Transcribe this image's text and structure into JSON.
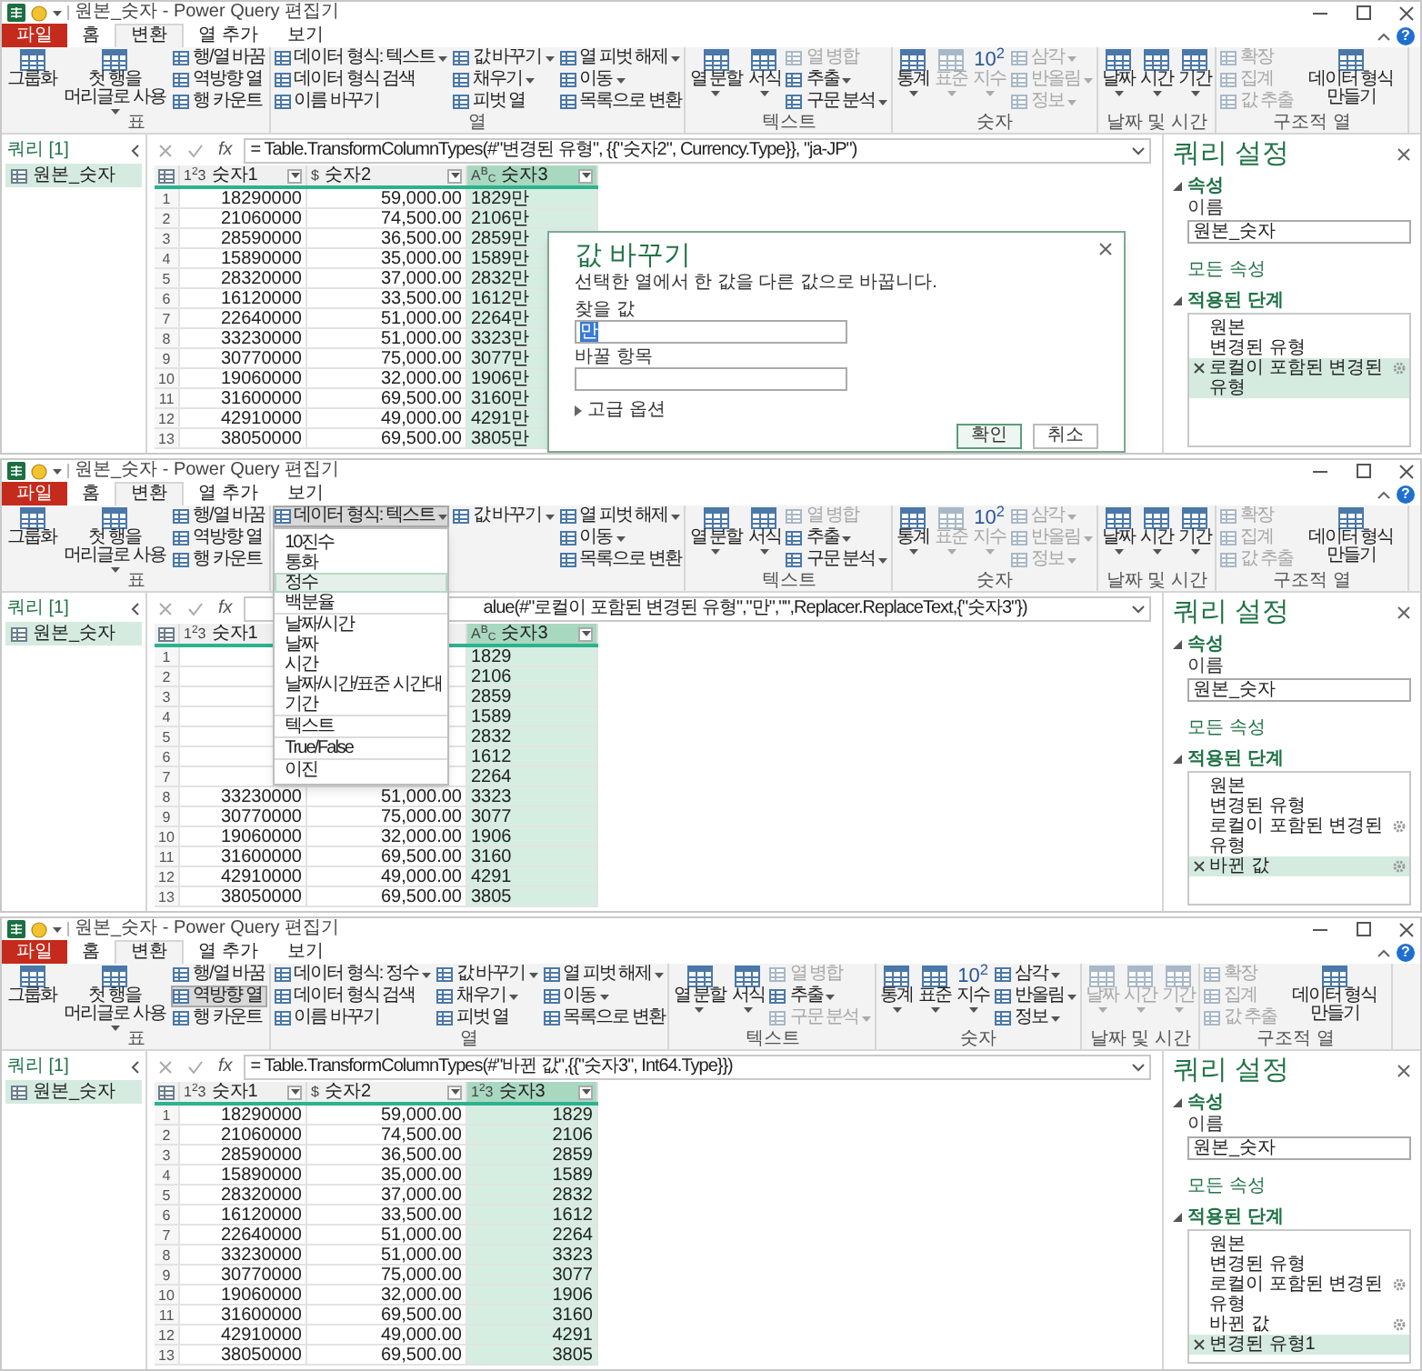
{
  "windows": [
    {
      "title": "원본_숫자 - Power Query 편집기",
      "tabs": [
        {
          "label": "파일",
          "kind": "file",
          "selected": false
        },
        {
          "label": "홈",
          "kind": "tab",
          "selected": false
        },
        {
          "label": "변환",
          "kind": "tab",
          "selected": true
        },
        {
          "label": "열 추가",
          "kind": "tab",
          "selected": false
        },
        {
          "label": "보기",
          "kind": "tab",
          "selected": false
        }
      ],
      "help": "?",
      "ribbon": [
        {
          "label": "표",
          "stacks": [
            [
              {
                "label": "그룹화",
                "kind": "large",
                "menu": false,
                "disabled": false,
                "pressed": false
              }
            ],
            [
              {
                "label": "첫 행을 머리글로 사용",
                "kind": "large",
                "menu": true,
                "disabled": false,
                "pressed": false
              }
            ],
            [
              {
                "label": "행/열 바꿈",
                "kind": "small",
                "menu": false,
                "disabled": false,
                "pressed": false
              },
              {
                "label": "역방향 열",
                "kind": "small",
                "menu": false,
                "disabled": false,
                "pressed": false
              },
              {
                "label": "행 카운트",
                "kind": "small",
                "menu": false,
                "disabled": false,
                "pressed": false
              }
            ]
          ]
        },
        {
          "label": "열",
          "stacks": [
            [
              {
                "label": "데이터 형식: 텍스트",
                "kind": "small",
                "menu": true,
                "disabled": false,
                "pressed": false
              },
              {
                "label": "데이터 형식 검색",
                "kind": "small",
                "menu": false,
                "disabled": false,
                "pressed": false
              },
              {
                "label": "이름 바꾸기",
                "kind": "small",
                "menu": false,
                "disabled": false,
                "pressed": false
              }
            ],
            [
              {
                "label": "값 바꾸기",
                "kind": "small",
                "menu": true,
                "disabled": false,
                "pressed": false
              },
              {
                "label": "채우기",
                "kind": "small",
                "menu": true,
                "disabled": false,
                "pressed": false
              },
              {
                "label": "피벗 열",
                "kind": "small",
                "menu": false,
                "disabled": false,
                "pressed": false
              }
            ],
            [
              {
                "label": "열 피벗 해제",
                "kind": "small",
                "menu": true,
                "disabled": false,
                "pressed": false
              },
              {
                "label": "이동",
                "kind": "small",
                "menu": true,
                "disabled": false,
                "pressed": false
              },
              {
                "label": "목록으로 변환",
                "kind": "small",
                "menu": false,
                "disabled": false,
                "pressed": false
              }
            ]
          ]
        },
        {
          "label": "텍스트",
          "stacks": [
            [
              {
                "label": "열 분할",
                "kind": "large",
                "menu": true,
                "disabled": false,
                "pressed": false
              }
            ],
            [
              {
                "label": "서식",
                "kind": "large",
                "menu": true,
                "disabled": false,
                "pressed": false
              }
            ],
            [
              {
                "label": "열 병합",
                "kind": "small",
                "menu": false,
                "disabled": true,
                "pressed": false
              },
              {
                "label": "추출",
                "kind": "small",
                "menu": true,
                "disabled": false,
                "pressed": false
              },
              {
                "label": "구문 분석",
                "kind": "small",
                "menu": true,
                "disabled": false,
                "pressed": false
              }
            ]
          ]
        },
        {
          "label": "숫자",
          "stacks": [
            [
              {
                "label": "통계",
                "kind": "large",
                "menu": true,
                "disabled": false,
                "pressed": false
              }
            ],
            [
              {
                "label": "표준",
                "kind": "large",
                "menu": true,
                "disabled": true,
                "pressed": false
              }
            ],
            [
              {
                "label": "지수",
                "glyph": "10$^{2}$",
                "kind": "large",
                "menu": true,
                "disabled": true,
                "pressed": false
              }
            ],
            [
              {
                "label": "삼각",
                "kind": "small",
                "menu": true,
                "disabled": true,
                "pressed": false
              },
              {
                "label": "반올림",
                "kind": "small",
                "menu": true,
                "disabled": true,
                "pressed": false
              },
              {
                "label": "정보",
                "kind": "small",
                "menu": true,
                "disabled": true,
                "pressed": false
              }
            ]
          ]
        },
        {
          "label": "날짜 및 시간",
          "stacks": [
            [
              {
                "label": "날짜",
                "kind": "large",
                "menu": true,
                "disabled": false,
                "pressed": false
              }
            ],
            [
              {
                "label": "시간",
                "kind": "large",
                "menu": true,
                "disabled": false,
                "pressed": false
              }
            ],
            [
              {
                "label": "기간",
                "kind": "large",
                "menu": true,
                "disabled": false,
                "pressed": false
              }
            ]
          ]
        },
        {
          "label": "구조적 열",
          "stacks": [
            [
              {
                "label": "확장",
                "kind": "small",
                "menu": false,
                "disabled": true,
                "pressed": false
              },
              {
                "label": "집계",
                "kind": "small",
                "menu": false,
                "disabled": true,
                "pressed": false
              },
              {
                "label": "값 추출",
                "kind": "small",
                "menu": false,
                "disabled": true,
                "pressed": false
              }
            ],
            [
              {
                "label": "데이터 형식 만들기",
                "kind": "large",
                "menu": false,
                "disabled": false,
                "pressed": false
              }
            ]
          ]
        }
      ],
      "queries": {
        "title": "쿼리 [1]",
        "items": [
          {
            "label": "원본_숫자",
            "selected": true
          }
        ]
      },
      "formula": {
        "fx": "fx",
        "text": "= Table.TransformColumnTypes(#\"변경된 유형\", {{\"숫자2\", Currency.Type}}, \"ja-JP\")"
      },
      "table": {
        "columns": [
          {
            "type_mark": "1$^{2}$3",
            "name": "숫자1",
            "kind": "integer",
            "filter": true,
            "selected": false
          },
          {
            "type_mark": "$",
            "name": "숫자2",
            "kind": "currency",
            "filter": true,
            "selected": false
          },
          {
            "type_mark": "A$^{B}$$_{C}$",
            "name": "숫자3",
            "kind": "text",
            "filter": true,
            "selected": true
          }
        ],
        "rows": [
          {
            "number": "1",
            "cells": [
              "18290000",
              "59,000.00",
              "1829만"
            ]
          },
          {
            "number": "2",
            "cells": [
              "21060000",
              "74,500.00",
              "2106만"
            ]
          },
          {
            "number": "3",
            "cells": [
              "28590000",
              "36,500.00",
              "2859만"
            ]
          },
          {
            "number": "4",
            "cells": [
              "15890000",
              "35,000.00",
              "1589만"
            ]
          },
          {
            "number": "5",
            "cells": [
              "28320000",
              "37,000.00",
              "2832만"
            ]
          },
          {
            "number": "6",
            "cells": [
              "16120000",
              "33,500.00",
              "1612만"
            ]
          },
          {
            "number": "7",
            "cells": [
              "22640000",
              "51,000.00",
              "2264만"
            ]
          },
          {
            "number": "8",
            "cells": [
              "33230000",
              "51,000.00",
              "3323만"
            ]
          },
          {
            "number": "9",
            "cells": [
              "30770000",
              "75,000.00",
              "3077만"
            ]
          },
          {
            "number": "10",
            "cells": [
              "19060000",
              "32,000.00",
              "1906만"
            ]
          },
          {
            "number": "11",
            "cells": [
              "31600000",
              "69,500.00",
              "3160만"
            ]
          },
          {
            "number": "12",
            "cells": [
              "42910000",
              "49,000.00",
              "4291만"
            ]
          },
          {
            "number": "13",
            "cells": [
              "38050000",
              "69,500.00",
              "3805만"
            ]
          }
        ]
      },
      "settings": {
        "title": "쿼리 설정",
        "properties": "속성",
        "name_label": "이름",
        "name_value": "원본_숫자",
        "all_properties": "모든 속성",
        "steps_title": "적용된 단계",
        "steps": [
          {
            "label": "원본",
            "has_settings": false,
            "selected": false
          },
          {
            "label": "변경된 유형",
            "has_settings": false,
            "selected": false
          },
          {
            "label": "로컬이 포함된 변경된 유형",
            "has_settings": true,
            "selected": true
          }
        ]
      },
      "dialog": {
        "title": "값 바꾸기",
        "description": "선택한 열에서 한 값을 다른 값으로 바꿉니다.",
        "find_label": "찾을 값",
        "find_value": "만",
        "find_value_selected": true,
        "replace_label": "바꿀 항목",
        "advanced": "고급 옵션",
        "buttons": [
          {
            "label": "확인",
            "kind": "primary"
          },
          {
            "label": "취소",
            "kind": "secondary"
          }
        ]
      }
    },
    {
      "title": "원본_숫자 - Power Query 편집기",
      "tabs": [
        {
          "label": "파일",
          "kind": "file",
          "selected": false
        },
        {
          "label": "홈",
          "kind": "tab",
          "selected": false
        },
        {
          "label": "변환",
          "kind": "tab",
          "selected": true
        },
        {
          "label": "열 추가",
          "kind": "tab",
          "selected": false
        },
        {
          "label": "보기",
          "kind": "tab",
          "selected": false
        }
      ],
      "help": "?",
      "ribbon": [
        {
          "label": "표",
          "stacks": [
            [
              {
                "label": "그룹화",
                "kind": "large",
                "menu": false,
                "disabled": false,
                "pressed": false
              }
            ],
            [
              {
                "label": "첫 행을 머리글로 사용",
                "kind": "large",
                "menu": true,
                "disabled": false,
                "pressed": false
              }
            ],
            [
              {
                "label": "행/열 바꿈",
                "kind": "small",
                "menu": false,
                "disabled": false,
                "pressed": false
              },
              {
                "label": "역방향 열",
                "kind": "small",
                "menu": false,
                "disabled": false,
                "pressed": false
              },
              {
                "label": "행 카운트",
                "kind": "small",
                "menu": false,
                "disabled": false,
                "pressed": false
              }
            ]
          ]
        },
        {
          "stacks": [
            [
              {
                "label": "데이터 형식: 텍스트",
                "kind": "small",
                "menu": true,
                "disabled": false,
                "pressed": true
              }
            ],
            [
              {
                "label": "값 바꾸기",
                "kind": "small",
                "menu": true,
                "disabled": false,
                "pressed": false
              }
            ],
            [
              {
                "label": "열 피벗 해제",
                "kind": "small",
                "menu": true,
                "disabled": false,
                "pressed": false
              },
              {
                "label": "이동",
                "kind": "small",
                "menu": true,
                "disabled": false,
                "pressed": false
              },
              {
                "label": "목록으로 변환",
                "kind": "small",
                "menu": false,
                "disabled": false,
                "pressed": false
              }
            ]
          ]
        },
        {
          "label": "텍스트",
          "stacks": [
            [
              {
                "label": "열 분할",
                "kind": "large",
                "menu": true,
                "disabled": false,
                "pressed": false
              }
            ],
            [
              {
                "label": "서식",
                "kind": "large",
                "menu": true,
                "disabled": false,
                "pressed": false
              }
            ],
            [
              {
                "label": "열 병합",
                "kind": "small",
                "menu": false,
                "disabled": true,
                "pressed": false
              },
              {
                "label": "추출",
                "kind": "small",
                "menu": true,
                "disabled": false,
                "pressed": false
              },
              {
                "label": "구문 분석",
                "kind": "small",
                "menu": true,
                "disabled": false,
                "pressed": false
              }
            ]
          ]
        },
        {
          "label": "숫자",
          "stacks": [
            [
              {
                "label": "통계",
                "kind": "large",
                "menu": true,
                "disabled": false,
                "pressed": false
              }
            ],
            [
              {
                "label": "표준",
                "kind": "large",
                "menu": true,
                "disabled": true,
                "pressed": false
              }
            ],
            [
              {
                "label": "지수",
                "glyph": "10$^{2}$",
                "kind": "large",
                "menu": true,
                "disabled": true,
                "pressed": false
              }
            ],
            [
              {
                "label": "삼각",
                "kind": "small",
                "menu": true,
                "disabled": true,
                "pressed": false
              },
              {
                "label": "반올림",
                "kind": "small",
                "menu": true,
                "disabled": true,
                "pressed": false
              },
              {
                "label": "정보",
                "kind": "small",
                "menu": true,
                "disabled": true,
                "pressed": false
              }
            ]
          ]
        },
        {
          "label": "날짜 및 시간",
          "stacks": [
            [
              {
                "label": "날짜",
                "kind": "large",
                "menu": true,
                "disabled": false,
                "pressed": false
              }
            ],
            [
              {
                "label": "시간",
                "kind": "large",
                "menu": true,
                "disabled": false,
                "pressed": false
              }
            ],
            [
              {
                "label": "기간",
                "kind": "large",
                "menu": true,
                "disabled": false,
                "pressed": false
              }
            ]
          ]
        },
        {
          "label": "구조적 열",
          "stacks": [
            [
              {
                "label": "확장",
                "kind": "small",
                "menu": false,
                "disabled": true,
                "pressed": false
              },
              {
                "label": "집계",
                "kind": "small",
                "menu": false,
                "disabled": true,
                "pressed": false
              },
              {
                "label": "값 추출",
                "kind": "small",
                "menu": false,
                "disabled": true,
                "pressed": false
              }
            ],
            [
              {
                "label": "데이터 형식 만들기",
                "kind": "large",
                "menu": false,
                "disabled": false,
                "pressed": false
              }
            ]
          ]
        }
      ],
      "queries": {
        "title": "쿼리 [1]",
        "items": [
          {
            "label": "원본_숫자",
            "selected": true
          }
        ]
      },
      "formula": {
        "fx": "fx",
        "text": "alue(#\"로컬이 포함된 변경된 유형\",\"만\",\"\",Replacer.ReplaceText,{\"숫자3\"})"
      },
      "table": {
        "columns": [
          {
            "type_mark": "1$^{2}$3",
            "name": "숫자1",
            "kind": "integer",
            "selected": false
          },
          {
            "kind": "currency"
          },
          {
            "type_mark": "A$^{B}$$_{C}$",
            "name": "숫자3",
            "kind": "text",
            "filter": true,
            "selected": true
          }
        ],
        "rows": [
          {
            "number": "1",
            "cells": [
              null,
              null,
              "1829"
            ]
          },
          {
            "number": "2",
            "cells": [
              null,
              null,
              "2106"
            ]
          },
          {
            "number": "3",
            "cells": [
              null,
              null,
              "2859"
            ]
          },
          {
            "number": "4",
            "cells": [
              null,
              null,
              "1589"
            ]
          },
          {
            "number": "5",
            "cells": [
              null,
              null,
              "2832"
            ]
          },
          {
            "number": "6",
            "cells": [
              null,
              null,
              "1612"
            ]
          },
          {
            "number": "7",
            "cells": [
              null,
              null,
              "2264"
            ]
          },
          {
            "number": "8",
            "cells": [
              "33230000",
              "51,000.00",
              "3323"
            ]
          },
          {
            "number": "9",
            "cells": [
              "30770000",
              "75,000.00",
              "3077"
            ]
          },
          {
            "number": "10",
            "cells": [
              "19060000",
              "32,000.00",
              "1906"
            ]
          },
          {
            "number": "11",
            "cells": [
              "31600000",
              "69,500.00",
              "3160"
            ]
          },
          {
            "number": "12",
            "cells": [
              "42910000",
              "49,000.00",
              "4291"
            ]
          },
          {
            "number": "13",
            "cells": [
              "38050000",
              "69,500.00",
              "3805"
            ]
          }
        ]
      },
      "settings": {
        "title": "쿼리 설정",
        "properties": "속성",
        "name_label": "이름",
        "name_value": "원본_숫자",
        "all_properties": "모든 속성",
        "steps_title": "적용된 단계",
        "steps": [
          {
            "label": "원본",
            "has_settings": false,
            "selected": false
          },
          {
            "label": "변경된 유형",
            "has_settings": false,
            "selected": false
          },
          {
            "label": "로컬이 포함된 변경된 유형",
            "has_settings": true,
            "selected": false
          },
          {
            "label": "바뀐 값",
            "has_settings": true,
            "selected": true
          }
        ]
      },
      "type_menu": {
        "groups": [
          [
            {
              "label": "10진수",
              "selected": false
            },
            {
              "label": "통화",
              "selected": false
            },
            {
              "label": "정수",
              "selected": true
            },
            {
              "label": "백분율",
              "selected": false
            }
          ],
          [
            {
              "label": "날짜/시간",
              "selected": false
            },
            {
              "label": "날짜",
              "selected": false
            },
            {
              "label": "시간",
              "selected": false
            },
            {
              "label": "날짜/시간/표준 시간대",
              "selected": false
            },
            {
              "label": "기간",
              "selected": false
            }
          ],
          [
            {
              "label": "텍스트",
              "selected": false
            }
          ],
          [
            {
              "label": "True/False",
              "selected": false
            }
          ],
          [
            {
              "label": "이진",
              "selected": false
            }
          ]
        ]
      }
    },
    {
      "title": "원본_숫자 - Power Query 편집기",
      "tabs": [
        {
          "label": "파일",
          "kind": "file",
          "selected": false
        },
        {
          "label": "홈",
          "kind": "tab",
          "selected": false
        },
        {
          "label": "변환",
          "kind": "tab",
          "selected": true
        },
        {
          "label": "열 추가",
          "kind": "tab",
          "selected": false
        },
        {
          "label": "보기",
          "kind": "tab",
          "selected": false
        }
      ],
      "help": "?",
      "ribbon": [
        {
          "label": "표",
          "stacks": [
            [
              {
                "label": "그룹화",
                "kind": "large",
                "menu": false,
                "disabled": false,
                "pressed": false
              }
            ],
            [
              {
                "label": "첫 행을 머리글로 사용",
                "kind": "large",
                "menu": true,
                "disabled": false,
                "pressed": false
              }
            ],
            [
              {
                "label": "행/열 바꿈",
                "kind": "small",
                "menu": false,
                "disabled": false,
                "pressed": false
              },
              {
                "label": "역방향 열",
                "kind": "small",
                "menu": false,
                "disabled": false,
                "pressed": true
              },
              {
                "label": "행 카운트",
                "kind": "small",
                "menu": false,
                "disabled": false,
                "pressed": false
              }
            ]
          ]
        },
        {
          "label": "열",
          "stacks": [
            [
              {
                "label": "데이터 형식: 정수",
                "kind": "small",
                "menu": true,
                "disabled": false,
                "pressed": false
              },
              {
                "label": "데이터 형식 검색",
                "kind": "small",
                "menu": false,
                "disabled": false,
                "pressed": false
              },
              {
                "label": "이름 바꾸기",
                "kind": "small",
                "menu": false,
                "disabled": false,
                "pressed": false
              }
            ],
            [
              {
                "label": "값 바꾸기",
                "kind": "small",
                "menu": true,
                "disabled": false,
                "pressed": false
              },
              {
                "label": "채우기",
                "kind": "small",
                "menu": true,
                "disabled": false,
                "pressed": false
              },
              {
                "label": "피벗 열",
                "kind": "small",
                "menu": false,
                "disabled": false,
                "pressed": false
              }
            ],
            [
              {
                "label": "열 피벗 해제",
                "kind": "small",
                "menu": true,
                "disabled": false,
                "pressed": false
              },
              {
                "label": "이동",
                "kind": "small",
                "menu": true,
                "disabled": false,
                "pressed": false
              },
              {
                "label": "목록으로 변환",
                "kind": "small",
                "menu": false,
                "disabled": false,
                "pressed": false
              }
            ]
          ]
        },
        {
          "label": "텍스트",
          "stacks": [
            [
              {
                "label": "열 분할",
                "kind": "large",
                "menu": true,
                "disabled": false,
                "pressed": false
              }
            ],
            [
              {
                "label": "서식",
                "kind": "large",
                "menu": true,
                "disabled": false,
                "pressed": false
              }
            ],
            [
              {
                "label": "열 병합",
                "kind": "small",
                "menu": false,
                "disabled": true,
                "pressed": false
              },
              {
                "label": "추출",
                "kind": "small",
                "menu": true,
                "disabled": false,
                "pressed": false
              },
              {
                "label": "구문 분석",
                "kind": "small",
                "menu": true,
                "disabled": true,
                "pressed": false
              }
            ]
          ]
        },
        {
          "label": "숫자",
          "stacks": [
            [
              {
                "label": "통계",
                "kind": "large",
                "menu": true,
                "disabled": false,
                "pressed": false
              }
            ],
            [
              {
                "label": "표준",
                "kind": "large",
                "menu": true,
                "disabled": false,
                "pressed": false
              }
            ],
            [
              {
                "label": "지수",
                "glyph": "10$^{2}$",
                "kind": "large",
                "menu": true,
                "disabled": false,
                "pressed": false
              }
            ],
            [
              {
                "label": "삼각",
                "kind": "small",
                "menu": true,
                "disabled": false,
                "pressed": false
              },
              {
                "label": "반올림",
                "kind": "small",
                "menu": true,
                "disabled": false,
                "pressed": false
              },
              {
                "label": "정보",
                "kind": "small",
                "menu": true,
                "disabled": false,
                "pressed": false
              }
            ]
          ]
        },
        {
          "label": "날짜 및 시간",
          "stacks": [
            [
              {
                "label": "날짜",
                "kind": "large",
                "menu": true,
                "disabled": true,
                "pressed": false
              }
            ],
            [
              {
                "label": "시간",
                "kind": "large",
                "menu": true,
                "disabled": true,
                "pressed": false
              }
            ],
            [
              {
                "label": "기간",
                "kind": "large",
                "menu": true,
                "disabled": true,
                "pressed": false
              }
            ]
          ]
        },
        {
          "label": "구조적 열",
          "stacks": [
            [
              {
                "label": "확장",
                "kind": "small",
                "menu": false,
                "disabled": true,
                "pressed": false
              },
              {
                "label": "집계",
                "kind": "small",
                "menu": false,
                "disabled": true,
                "pressed": false
              },
              {
                "label": "값 추출",
                "kind": "small",
                "menu": false,
                "disabled": true,
                "pressed": false
              }
            ],
            [
              {
                "label": "데이터 형식 만들기",
                "kind": "large",
                "menu": false,
                "disabled": false,
                "pressed": false
              }
            ]
          ]
        }
      ],
      "queries": {
        "title": "쿼리 [1]",
        "items": [
          {
            "label": "원본_숫자",
            "selected": true
          }
        ]
      },
      "formula": {
        "fx": "fx",
        "text": "= Table.TransformColumnTypes(#\"바뀐 값\",{{\"숫자3\", Int64.Type}})"
      },
      "table": {
        "columns": [
          {
            "type_mark": "1$^{2}$3",
            "name": "숫자1",
            "kind": "integer",
            "filter": true,
            "selected": false
          },
          {
            "type_mark": "$",
            "name": "숫자2",
            "kind": "currency",
            "filter": true,
            "selected": false
          },
          {
            "type_mark": "1$^{2}$3",
            "name": "숫자3",
            "kind": "integer",
            "filter": true,
            "selected": true
          }
        ],
        "rows": [
          {
            "number": "1",
            "cells": [
              "18290000",
              "59,000.00",
              "1829"
            ]
          },
          {
            "number": "2",
            "cells": [
              "21060000",
              "74,500.00",
              "2106"
            ]
          },
          {
            "number": "3",
            "cells": [
              "28590000",
              "36,500.00",
              "2859"
            ]
          },
          {
            "number": "4",
            "cells": [
              "15890000",
              "35,000.00",
              "1589"
            ]
          },
          {
            "number": "5",
            "cells": [
              "28320000",
              "37,000.00",
              "2832"
            ]
          },
          {
            "number": "6",
            "cells": [
              "16120000",
              "33,500.00",
              "1612"
            ]
          },
          {
            "number": "7",
            "cells": [
              "22640000",
              "51,000.00",
              "2264"
            ]
          },
          {
            "number": "8",
            "cells": [
              "33230000",
              "51,000.00",
              "3323"
            ]
          },
          {
            "number": "9",
            "cells": [
              "30770000",
              "75,000.00",
              "3077"
            ]
          },
          {
            "number": "10",
            "cells": [
              "19060000",
              "32,000.00",
              "1906"
            ]
          },
          {
            "number": "11",
            "cells": [
              "31600000",
              "69,500.00",
              "3160"
            ]
          },
          {
            "number": "12",
            "cells": [
              "42910000",
              "49,000.00",
              "4291"
            ]
          },
          {
            "number": "13",
            "cells": [
              "38050000",
              "69,500.00",
              "3805"
            ]
          }
        ]
      },
      "settings": {
        "title": "쿼리 설정",
        "properties": "속성",
        "name_label": "이름",
        "name_value": "원본_숫자",
        "all_properties": "모든 속성",
        "steps_title": "적용된 단계",
        "steps": [
          {
            "label": "원본",
            "has_settings": false,
            "selected": false
          },
          {
            "label": "변경된 유형",
            "has_settings": false,
            "selected": false
          },
          {
            "label": "로컬이 포함된 변경된 유형",
            "has_settings": true,
            "selected": false
          },
          {
            "label": "바뀐 값",
            "has_settings": true,
            "selected": false
          },
          {
            "label": "변경된 유형1",
            "has_settings": false,
            "selected": true
          }
        ]
      }
    }
  ]
}
